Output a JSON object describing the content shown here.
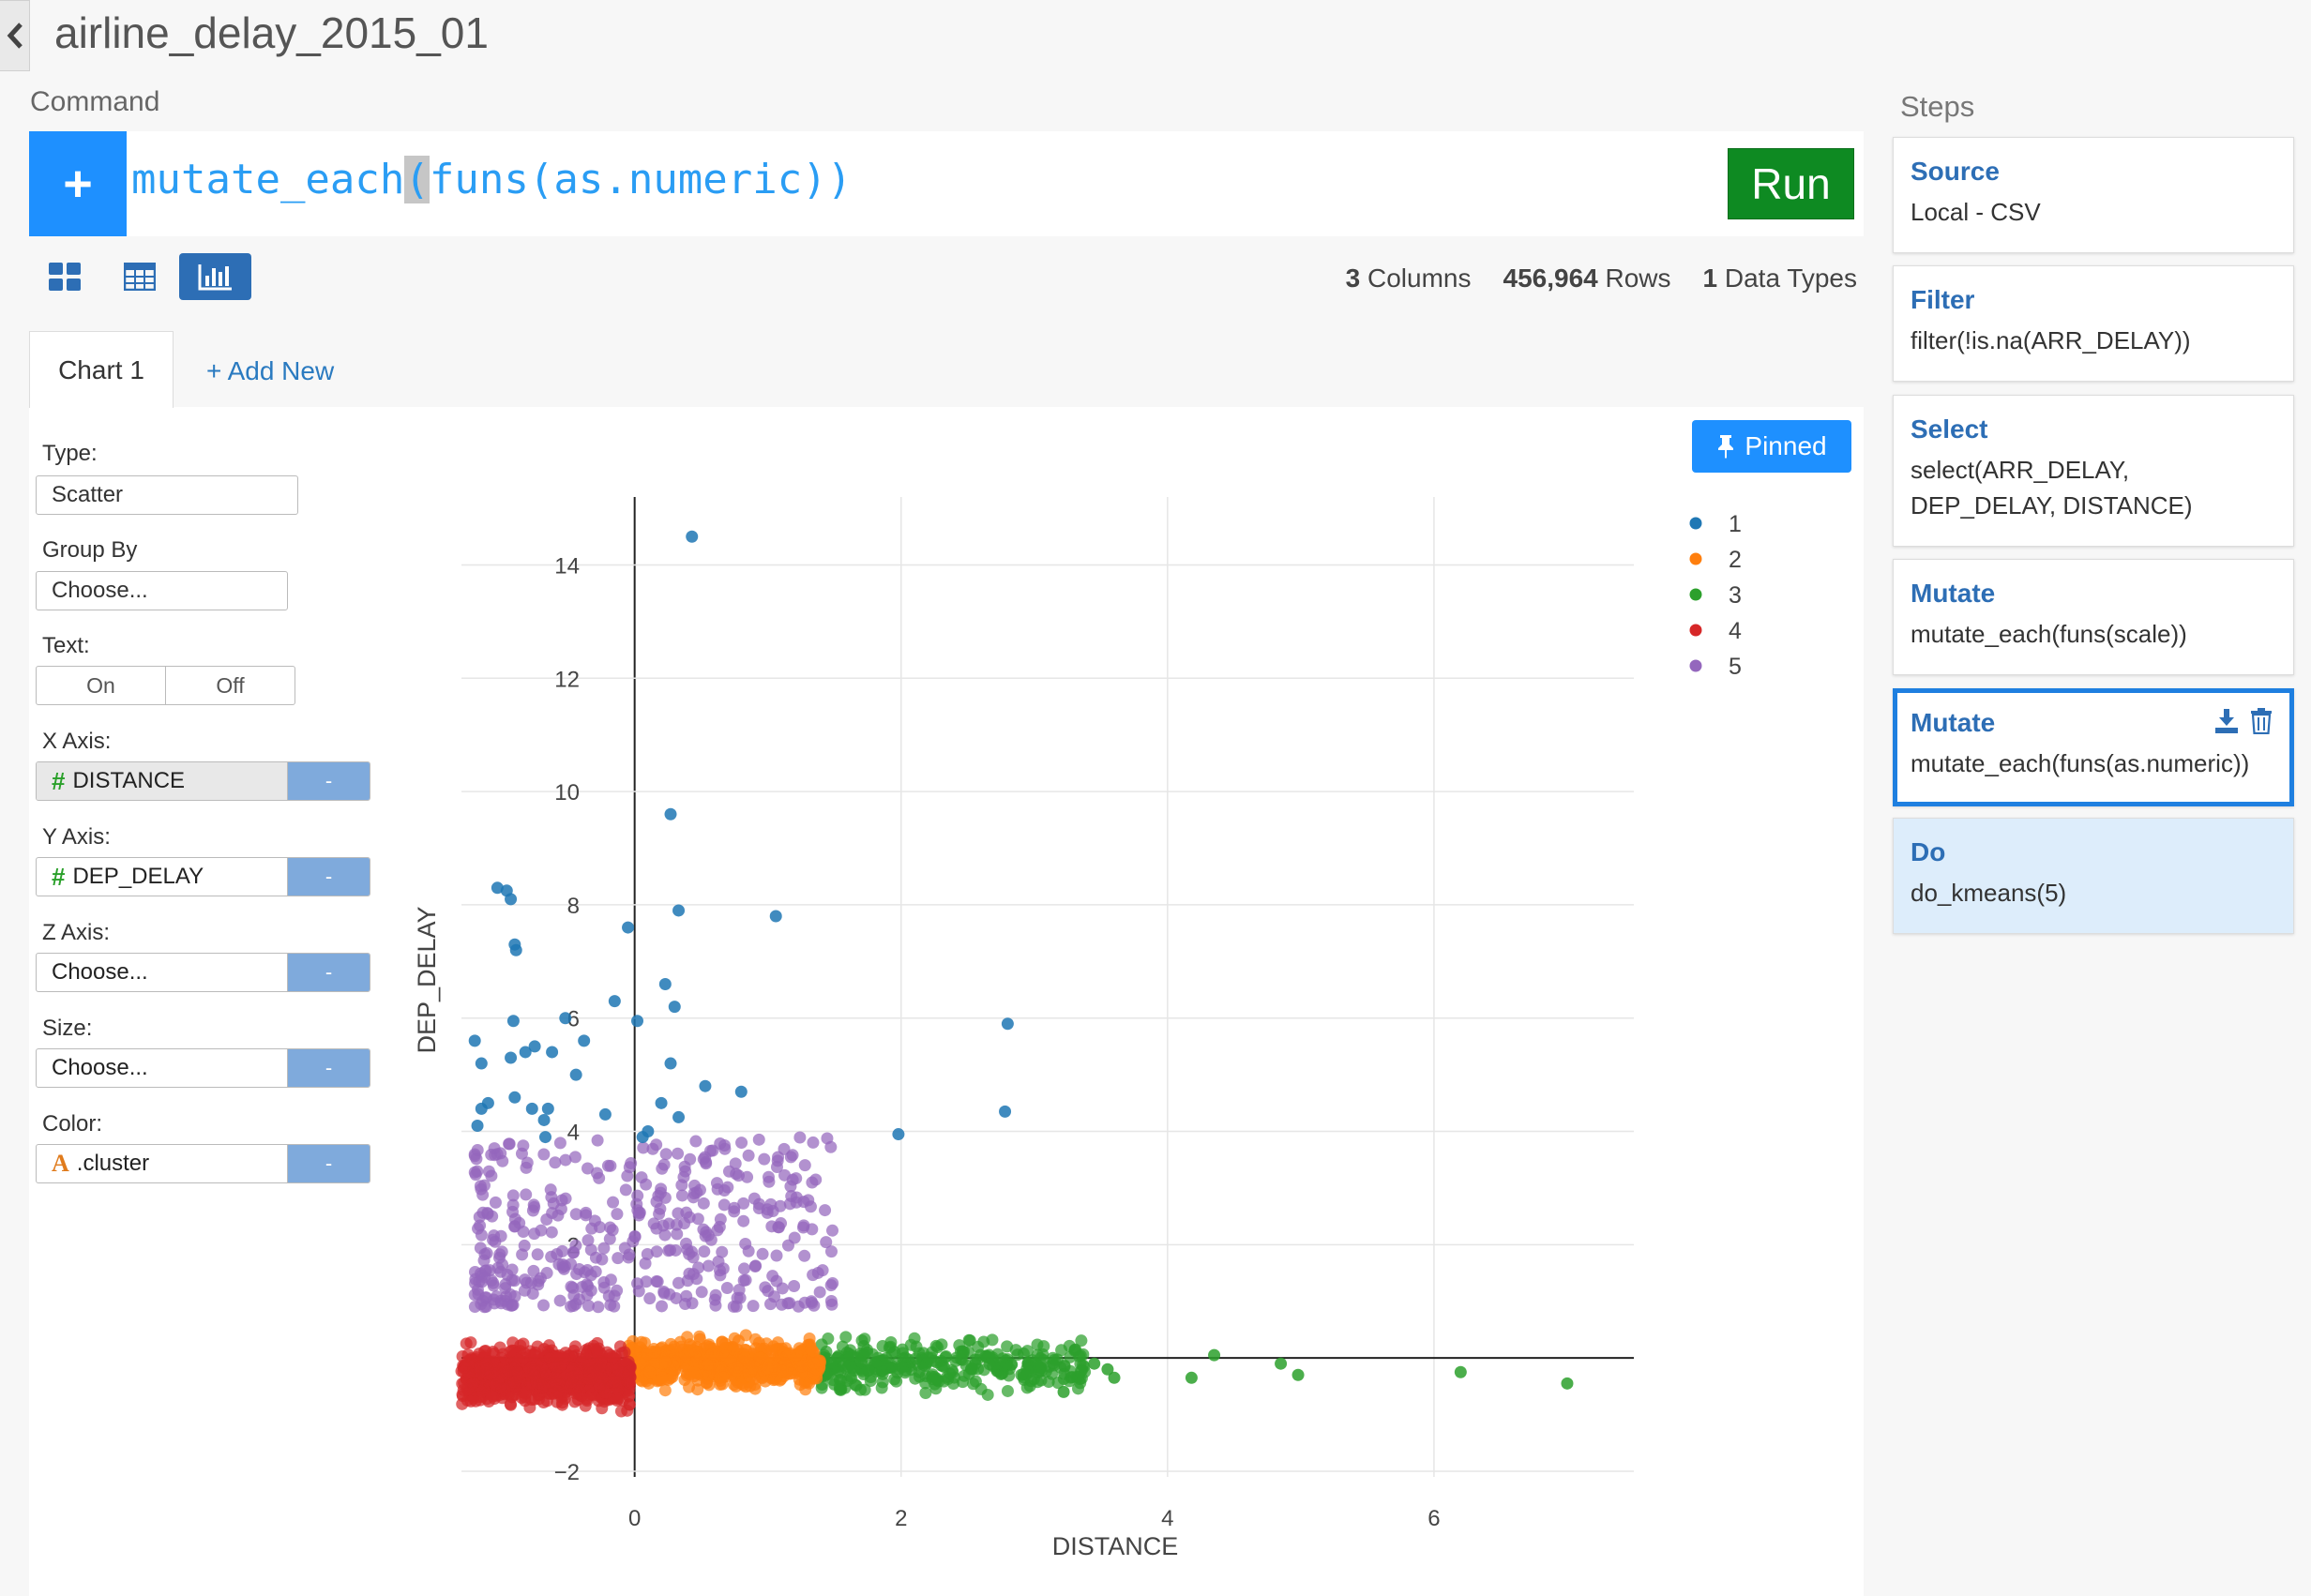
{
  "header": {
    "title": "airline_delay_2015_01"
  },
  "command": {
    "label": "Command",
    "text_before": "mutate_each",
    "text_cursor": "(",
    "text_after": "funs(as.numeric))",
    "run_label": "Run"
  },
  "stats": {
    "columns_value": "3",
    "columns_label": "Columns",
    "rows_value": "456,964",
    "rows_label": "Rows",
    "types_value": "1",
    "types_label": "Data Types"
  },
  "tabs": {
    "active": "Chart 1",
    "add": "+ Add New"
  },
  "config": {
    "type_label": "Type:",
    "type_value": "Scatter",
    "group_label": "Group By",
    "group_value": "Choose...",
    "text_label": "Text:",
    "text_on": "On",
    "text_off": "Off",
    "x_label": "X Axis:",
    "x_value": "DISTANCE",
    "y_label": "Y Axis:",
    "y_value": "DEP_DELAY",
    "z_label": "Z Axis:",
    "z_value": "Choose...",
    "size_label": "Size:",
    "size_value": "Choose...",
    "color_label": "Color:",
    "color_value": ".cluster",
    "minus": "-"
  },
  "pinned_label": "Pinned",
  "chart_data": {
    "type": "scatter",
    "xlabel": "DISTANCE",
    "ylabel": "DEP_DELAY",
    "xlim": [
      -1.3,
      7.5
    ],
    "ylim": [
      -2.1,
      15.2
    ],
    "xticks": [
      0,
      2,
      4,
      6
    ],
    "yticks": [
      -2,
      0,
      2,
      4,
      6,
      8,
      10,
      12,
      14
    ],
    "grid": true,
    "legend_position": "top-right",
    "series": [
      {
        "name": "1",
        "color": "#1f77b4",
        "points": [
          [
            0.43,
            14.5
          ],
          [
            0.27,
            9.6
          ],
          [
            0.33,
            7.9
          ],
          [
            1.06,
            7.8
          ],
          [
            -0.05,
            7.6
          ],
          [
            -1.03,
            8.3
          ],
          [
            -0.96,
            8.25
          ],
          [
            -0.93,
            8.1
          ],
          [
            -0.9,
            7.3
          ],
          [
            -0.89,
            7.2
          ],
          [
            0.23,
            6.6
          ],
          [
            0.3,
            6.2
          ],
          [
            -0.15,
            6.3
          ],
          [
            0.02,
            5.95
          ],
          [
            2.8,
            5.9
          ],
          [
            -0.52,
            6.0
          ],
          [
            -0.91,
            5.95
          ],
          [
            -1.2,
            5.6
          ],
          [
            -0.82,
            5.4
          ],
          [
            -0.75,
            5.5
          ],
          [
            -1.15,
            5.2
          ],
          [
            -0.38,
            5.6
          ],
          [
            0.27,
            5.2
          ],
          [
            -0.62,
            5.4
          ],
          [
            -0.44,
            5.0
          ],
          [
            0.53,
            4.8
          ],
          [
            0.8,
            4.7
          ],
          [
            -1.15,
            4.4
          ],
          [
            -1.1,
            4.5
          ],
          [
            -0.9,
            4.6
          ],
          [
            -0.77,
            4.4
          ],
          [
            -0.68,
            4.2
          ],
          [
            -0.65,
            4.4
          ],
          [
            -0.22,
            4.3
          ],
          [
            0.2,
            4.5
          ],
          [
            -1.18,
            4.1
          ],
          [
            -0.67,
            3.9
          ],
          [
            0.1,
            4.0
          ],
          [
            0.06,
            3.9
          ],
          [
            1.98,
            3.95
          ],
          [
            2.78,
            4.35
          ],
          [
            -0.93,
            5.3
          ],
          [
            0.33,
            4.25
          ]
        ]
      },
      {
        "name": "2",
        "color": "#ff7f0e"
      },
      {
        "name": "3",
        "color": "#2ca02c",
        "points": [
          [
            4.35,
            0.05
          ],
          [
            4.85,
            -0.1
          ],
          [
            4.98,
            -0.3
          ],
          [
            6.2,
            -0.25
          ],
          [
            7.0,
            -0.45
          ],
          [
            4.18,
            -0.35
          ],
          [
            3.6,
            -0.35
          ],
          [
            3.55,
            -0.2
          ],
          [
            3.22,
            -0.6
          ],
          [
            3.45,
            -0.1
          ]
        ]
      },
      {
        "name": "4",
        "color": "#d62728"
      },
      {
        "name": "5",
        "color": "#9467bd"
      }
    ]
  },
  "steps": {
    "title": "Steps",
    "items": [
      {
        "title": "Source",
        "desc": "Local - CSV"
      },
      {
        "title": "Filter",
        "desc": "filter(!is.na(ARR_DELAY))"
      },
      {
        "title": "Select",
        "desc": "select(ARR_DELAY, DEP_DELAY, DISTANCE)"
      },
      {
        "title": "Mutate",
        "desc": "mutate_each(funs(scale))"
      },
      {
        "title": "Mutate",
        "desc": "mutate_each(funs(as.numeric))"
      },
      {
        "title": "Do",
        "desc": "do_kmeans(5)"
      }
    ]
  }
}
